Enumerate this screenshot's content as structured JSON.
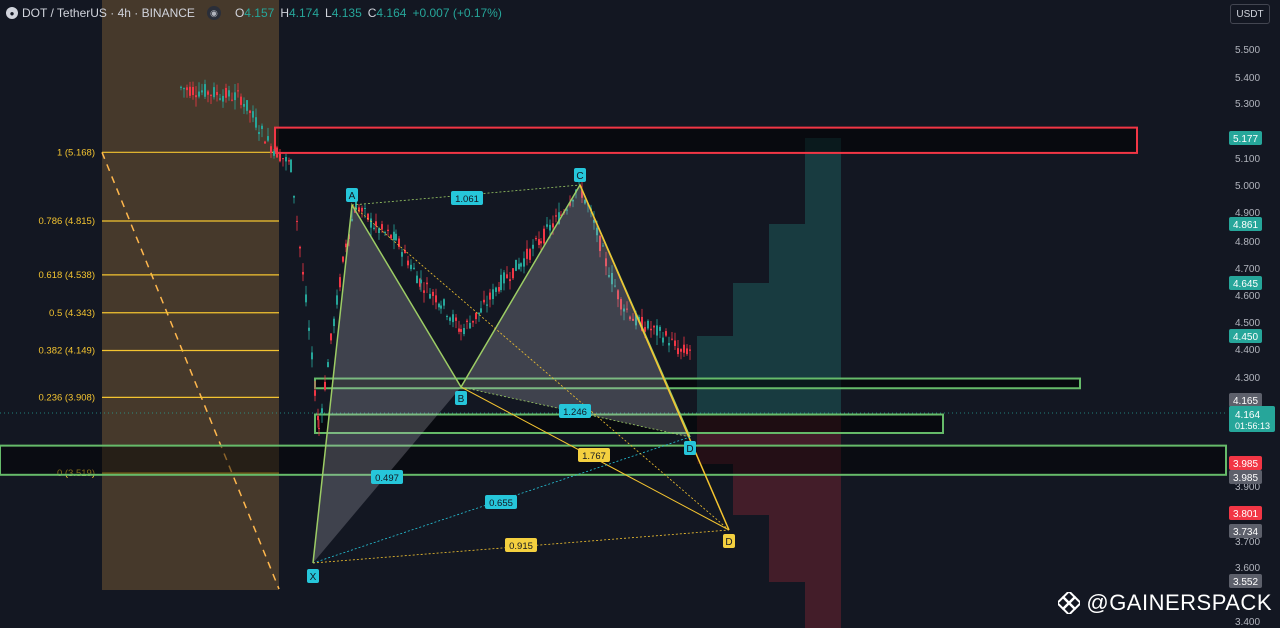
{
  "header": {
    "symbol": "DOT / TetherUS · 4h · BINANCE",
    "open_label": "O",
    "open": "4.157",
    "high_label": "H",
    "high": "4.174",
    "low_label": "L",
    "low": "4.135",
    "close_label": "C",
    "close": "4.164",
    "change": "+0.007 (+0.17%)"
  },
  "currency_button": "USDT",
  "watermark": "@GAINERSPACK",
  "chart_data": {
    "type": "candlestick",
    "y_axis": {
      "ticks": [
        "5.500",
        "5.400",
        "5.300",
        "5.100",
        "5.000",
        "4.900",
        "4.800",
        "4.700",
        "4.600",
        "4.500",
        "4.400",
        "4.300",
        "3.900",
        "3.700",
        "3.600",
        "3.400"
      ]
    },
    "price_badges": [
      {
        "text": "5.177",
        "bg": "#26a69a"
      },
      {
        "text": "4.861",
        "bg": "#26a69a"
      },
      {
        "text": "4.645",
        "bg": "#26a69a"
      },
      {
        "text": "4.450",
        "bg": "#26a69a"
      },
      {
        "text": "4.165",
        "bg": "#5d606b"
      },
      {
        "text": "3.985",
        "bg": "#f23645"
      },
      {
        "text": "3.985",
        "bg": "#5d606b"
      },
      {
        "text": "3.801",
        "bg": "#f23645"
      },
      {
        "text": "3.734",
        "bg": "#5d606b"
      },
      {
        "text": "3.552",
        "bg": "#5d606b"
      }
    ],
    "current_price": {
      "text": "4.164",
      "timer": "01:56:13",
      "bg": "#26a69a"
    },
    "fib_levels": [
      {
        "label": "1 (5.168)",
        "price": 5.168
      },
      {
        "label": "0.786 (4.815)",
        "price": 4.815
      },
      {
        "label": "0.618 (4.538)",
        "price": 4.538
      },
      {
        "label": "0.5 (4.343)",
        "price": 4.343
      },
      {
        "label": "0.382 (4.149)",
        "price": 4.149
      },
      {
        "label": "0.236 (3.908)",
        "price": 3.908
      },
      {
        "label": "0 (3.519)",
        "price": 3.519
      }
    ],
    "pattern_points": [
      {
        "label": "X",
        "price": 3.62
      },
      {
        "label": "A",
        "price": 4.92
      },
      {
        "label": "B",
        "price": 4.27
      },
      {
        "label": "C",
        "price": 5.02
      },
      {
        "label": "D",
        "price": 4.18
      },
      {
        "label": "D",
        "price": 3.75
      }
    ],
    "ratios": [
      "1.061",
      "1.246",
      "1.767",
      "0.497",
      "0.655",
      "0.915"
    ],
    "zones": [
      {
        "top": 5.295,
        "bottom": 5.165,
        "color": "#f23645"
      },
      {
        "top": 4.005,
        "bottom": 3.955,
        "color": "#66bb6a"
      },
      {
        "top": 3.82,
        "bottom": 3.725,
        "color": "#66bb6a"
      },
      {
        "top": 3.66,
        "bottom": 3.51,
        "color": "#66bb6a"
      }
    ]
  }
}
